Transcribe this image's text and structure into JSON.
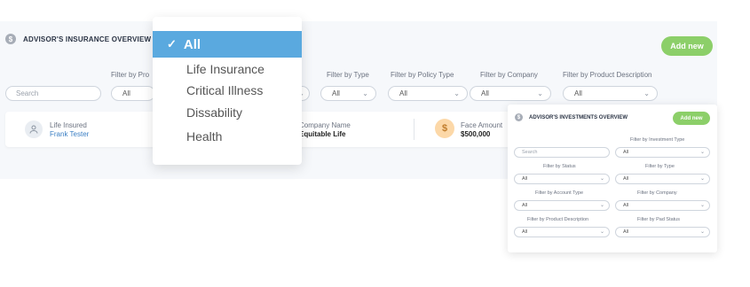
{
  "overview": {
    "title": "ADVISOR'S INSURANCE OVERVIEW",
    "add_new": "Add new",
    "search_placeholder": "Search",
    "filters": [
      {
        "label": "Filter by Pro",
        "value": "All"
      },
      {
        "label": "Filter by Type",
        "value": "All"
      },
      {
        "label": "Filter by Policy Type",
        "value": "All"
      },
      {
        "label": "Filter by Company",
        "value": "All"
      },
      {
        "label": "Filter by Product Description",
        "value": "All"
      }
    ],
    "record": {
      "life_insured_label": "Life Insured",
      "life_insured_value": "Frank Tester",
      "company_label": "Company Name",
      "company_value": "Equitable Life",
      "face_amount_label": "Face Amount",
      "face_amount_value": "$500,000",
      "coin_symbol": "$"
    }
  },
  "dropdown": {
    "selected": "All",
    "items": [
      "Life Insurance",
      "Critical Illness",
      "Dissability",
      "Health"
    ]
  },
  "investments": {
    "title": "ADVISOR'S INVESTMENTS OVERVIEW",
    "add_new": "Add new",
    "search_placeholder": "Search",
    "filters": [
      {
        "label": "Filter by Investment Type",
        "value": "All"
      },
      {
        "label": "Filter by Status",
        "value": "All"
      },
      {
        "label": "Filter by Type",
        "value": "All"
      },
      {
        "label": "Filter by Account Type",
        "value": "All"
      },
      {
        "label": "Filter by Company",
        "value": "All"
      },
      {
        "label": "Filter by Product Description",
        "value": "All"
      },
      {
        "label": "Filter by Pad Status",
        "value": "All"
      }
    ]
  },
  "colors": {
    "accent_green": "#8ccf69",
    "selected_blue": "#5aa9df",
    "link_blue": "#3b7fc4",
    "coin_bg": "#fcd8a8"
  }
}
